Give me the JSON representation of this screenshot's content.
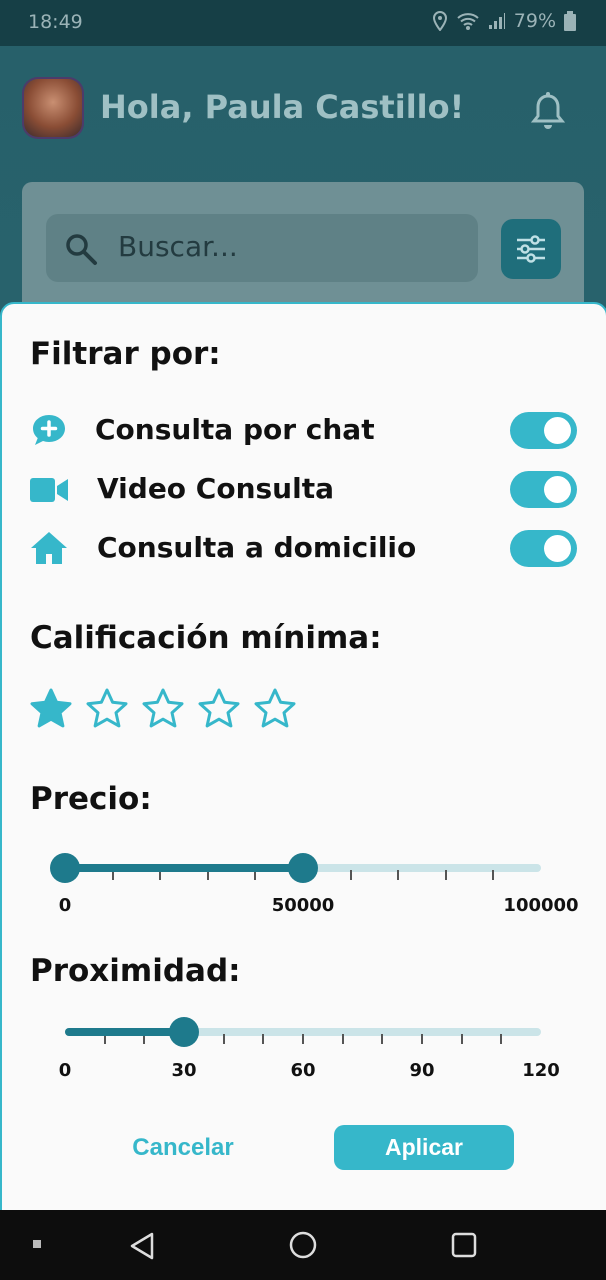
{
  "status_bar": {
    "time": "18:49",
    "battery": "79%"
  },
  "header": {
    "greeting": "Hola, Paula Castillo!"
  },
  "search": {
    "placeholder": "Buscar..."
  },
  "filter_sheet": {
    "title": "Filtrar por:",
    "options": [
      {
        "label": "Consulta por chat",
        "icon": "chat-plus-icon",
        "enabled": true
      },
      {
        "label": "Video Consulta",
        "icon": "video-camera-icon",
        "enabled": true
      },
      {
        "label": "Consulta a domicilio",
        "icon": "home-icon",
        "enabled": true
      }
    ],
    "rating": {
      "title": "Calificación mínima:",
      "selected": 1,
      "max": 5
    },
    "price": {
      "title": "Precio:",
      "value": 50000,
      "labels": [
        "0",
        "50000",
        "100000"
      ]
    },
    "proximity": {
      "title": "Proximidad:",
      "value": 30,
      "labels": [
        "0",
        "30",
        "60",
        "90",
        "120"
      ]
    },
    "cancel_label": "Cancelar",
    "apply_label": "Aplicar"
  },
  "colors": {
    "accent": "#36b7ca",
    "dark_accent": "#1e7a8c"
  }
}
